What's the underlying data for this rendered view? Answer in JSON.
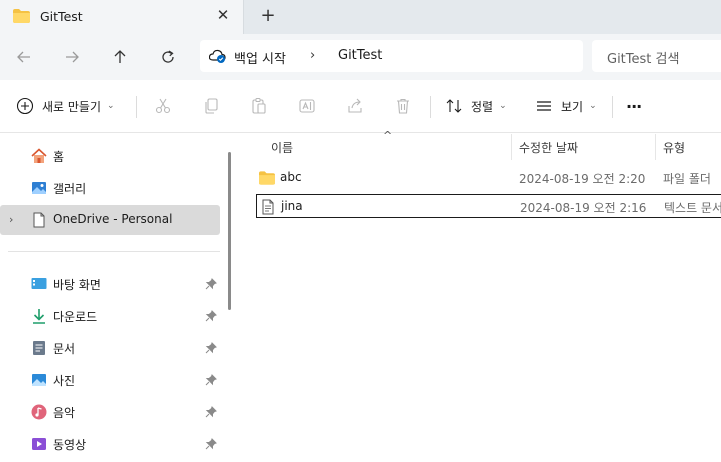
{
  "tab": {
    "title": "GitTest",
    "close": "✕",
    "new_tab": "+"
  },
  "address": {
    "root": "백업 시작",
    "separator": "›",
    "folder": "GitTest"
  },
  "search": {
    "placeholder": "GitTest 검색"
  },
  "toolbar": {
    "new_label": "새로 만들기",
    "sort_label": "정렬",
    "view_label": "보기",
    "more": "···",
    "caret": "⌄"
  },
  "sidebar": {
    "items": [
      {
        "label": "홈",
        "icon": "home-icon"
      },
      {
        "label": "갤러리",
        "icon": "gallery-icon"
      },
      {
        "label": "OneDrive - Personal",
        "icon": "document-icon"
      },
      {
        "label": "바탕 화면",
        "icon": "desktop-icon"
      },
      {
        "label": "다운로드",
        "icon": "download-icon"
      },
      {
        "label": "문서",
        "icon": "documents-icon"
      },
      {
        "label": "사진",
        "icon": "pictures-icon"
      },
      {
        "label": "음악",
        "icon": "music-icon"
      },
      {
        "label": "동영상",
        "icon": "videos-icon"
      }
    ],
    "chevron": "›"
  },
  "filelist": {
    "sort_indicator": "^",
    "columns": {
      "name": "이름",
      "date": "수정한 날짜",
      "type": "유형"
    },
    "rows": [
      {
        "name": "abc",
        "date": "2024-08-19 오전 2:20",
        "type": "파일 폴더"
      },
      {
        "name": "jina",
        "date": "2024-08-19 오전 2:16",
        "type": "텍스트 문서"
      }
    ]
  },
  "colors": {
    "folder": "#f5c244",
    "accent": "#0067c0",
    "selected": "#dadada"
  }
}
